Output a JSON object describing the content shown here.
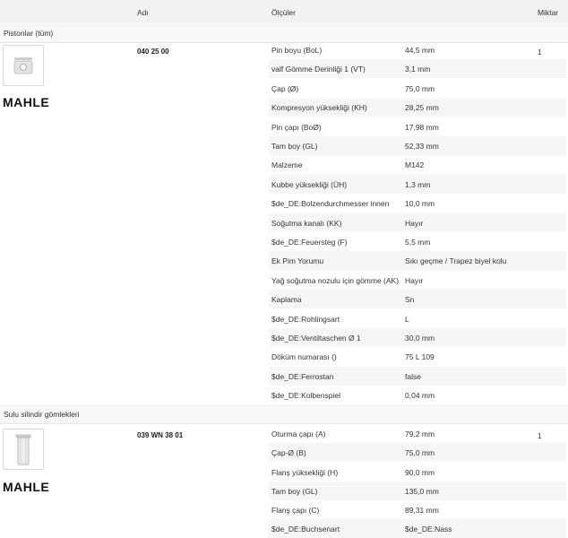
{
  "header": {
    "name": "Adı",
    "dimensions": "Ölçüler",
    "quantity": "Miktar"
  },
  "sections": [
    {
      "title": "Pistonlar (tüm)",
      "article_number": "040 25 00",
      "brand": "MAHLE",
      "quantity": "1",
      "rows": [
        {
          "name": "Pin boyu (BoL)",
          "value": "44,5 mm"
        },
        {
          "name": "valf Gömme Derinliği 1 (VT)",
          "value": "3,1 mm"
        },
        {
          "name": "Çap (Ø)",
          "value": "75,0 mm"
        },
        {
          "name": "Kompresyon yüksekliği (KH)",
          "value": "28,25 mm"
        },
        {
          "name": "Pin çapı (BoØ)",
          "value": "17,98 mm"
        },
        {
          "name": "Tam boy (GL)",
          "value": "52,33 mm"
        },
        {
          "name": "Malzeme",
          "value": "M142"
        },
        {
          "name": "Kubbe yüksekliği (ÜH)",
          "value": "1,3 mm"
        },
        {
          "name": "$de_DE:Bolzendurchmesser innen",
          "value": "10,0 mm"
        },
        {
          "name": "Soğutma kanalı (KK)",
          "value": "Hayır"
        },
        {
          "name": "$de_DE:Feuersteg (F)",
          "value": "5,5 mm"
        },
        {
          "name": "Ek Pim Yorumu",
          "value": "Sıkı geçme / Trapez biyel kolu"
        },
        {
          "name": "Yağ soğutma nozulu için gömme (AK)",
          "value": "Hayır"
        },
        {
          "name": "Kaplama",
          "value": "Sn"
        },
        {
          "name": "$de_DE:Rohlingsart",
          "value": "L"
        },
        {
          "name": "$de_DE:Ventiltaschen Ø 1",
          "value": "30,0 mm"
        },
        {
          "name": "Döküm numarası ()",
          "value": "75 L 109"
        },
        {
          "name": "$de_DE:Ferrostan",
          "value": "false"
        },
        {
          "name": "$de_DE:Kolbenspiel",
          "value": "0,04 mm"
        }
      ]
    },
    {
      "title": "Sulu silindir gömlekleri",
      "article_number": "039 WN 38 01",
      "brand": "MAHLE",
      "quantity": "1",
      "rows": [
        {
          "name": "Oturma çapı (A)",
          "value": "79,2 mm"
        },
        {
          "name": "Çap-Ø (B)",
          "value": "75,0 mm"
        },
        {
          "name": "Flanş yüksekliği (H)",
          "value": "90,0 mm"
        },
        {
          "name": "Tam boy (GL)",
          "value": "135,0 mm"
        },
        {
          "name": "Flanş çapı (C)",
          "value": "89,31 mm"
        },
        {
          "name": "$de_DE:Buchsenart",
          "value": "$de_DE:Nass"
        }
      ]
    }
  ]
}
